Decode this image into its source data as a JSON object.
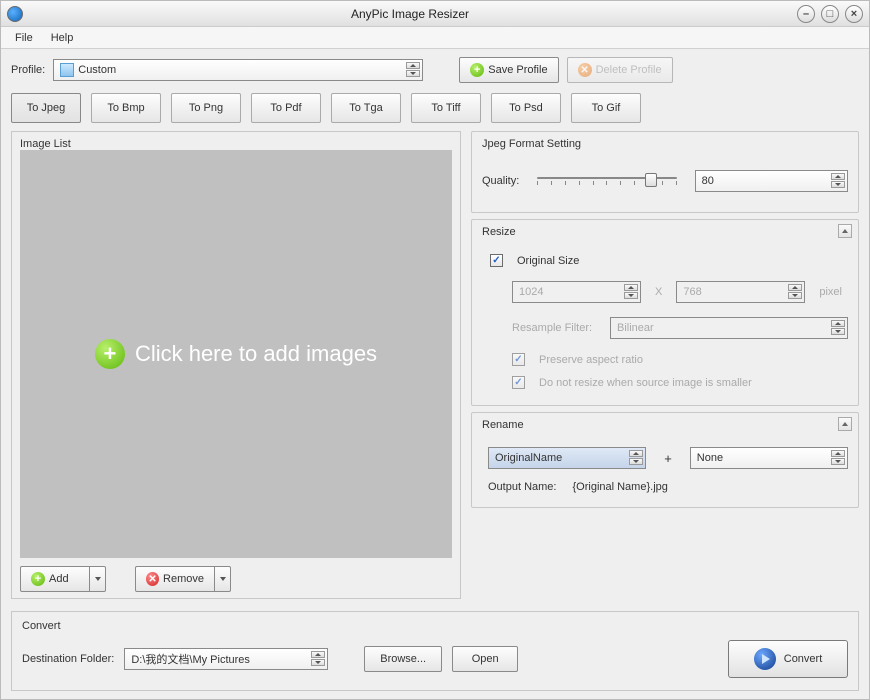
{
  "title": "AnyPic Image Resizer",
  "menu": {
    "file": "File",
    "help": "Help"
  },
  "profile": {
    "label": "Profile:",
    "value": "Custom",
    "save": "Save Profile",
    "delete": "Delete Profile"
  },
  "tabs": [
    "To Jpeg",
    "To Bmp",
    "To Png",
    "To Pdf",
    "To Tga",
    "To Tiff",
    "To Psd",
    "To Gif"
  ],
  "activeTab": 0,
  "imagelist": {
    "title": "Image List",
    "drop": "Click here  to add images",
    "add": "Add",
    "remove": "Remove"
  },
  "jpeg": {
    "title": "Jpeg Format Setting",
    "quality_label": "Quality:",
    "quality": "80"
  },
  "resize": {
    "title": "Resize",
    "original": "Original Size",
    "w": "1024",
    "h": "768",
    "x": "X",
    "px": "pixel",
    "filter_label": "Resample Filter:",
    "filter": "Bilinear",
    "aspect": "Preserve aspect ratio",
    "nosmaller": "Do not resize when source image is smaller"
  },
  "rename": {
    "title": "Rename",
    "left": "OriginalName",
    "right": "None",
    "plus": "+",
    "out_label": "Output Name:",
    "out_value": "{Original Name}.jpg"
  },
  "convert": {
    "title": "Convert",
    "dest_label": "Destination Folder:",
    "dest": "D:\\我的文档\\My Pictures",
    "browse": "Browse...",
    "open": "Open",
    "go": "Convert"
  }
}
